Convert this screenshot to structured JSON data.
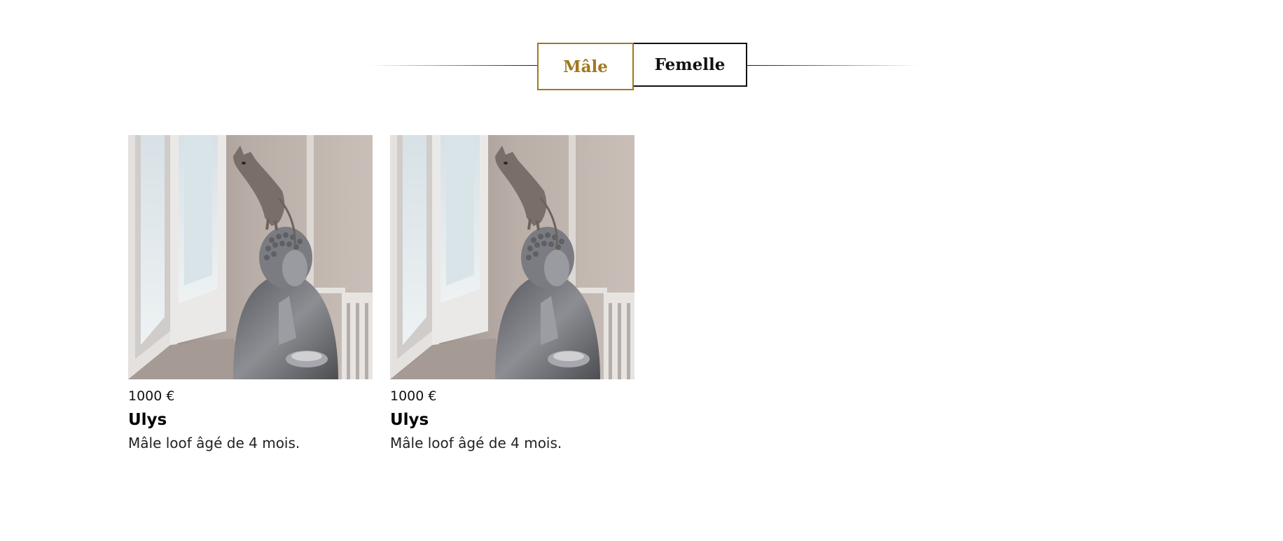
{
  "tabs": {
    "male_label": "Mâle",
    "female_label": "Femelle",
    "active": "Mâle"
  },
  "colors": {
    "accent": "#a0791c",
    "text": "#111111"
  },
  "products": [
    {
      "price": "1000 €",
      "name": "Ulys",
      "description": "Mâle loof âgé de 4 mois."
    },
    {
      "price": "1000 €",
      "name": "Ulys",
      "description": "Mâle loof âgé de 4 mois."
    }
  ]
}
